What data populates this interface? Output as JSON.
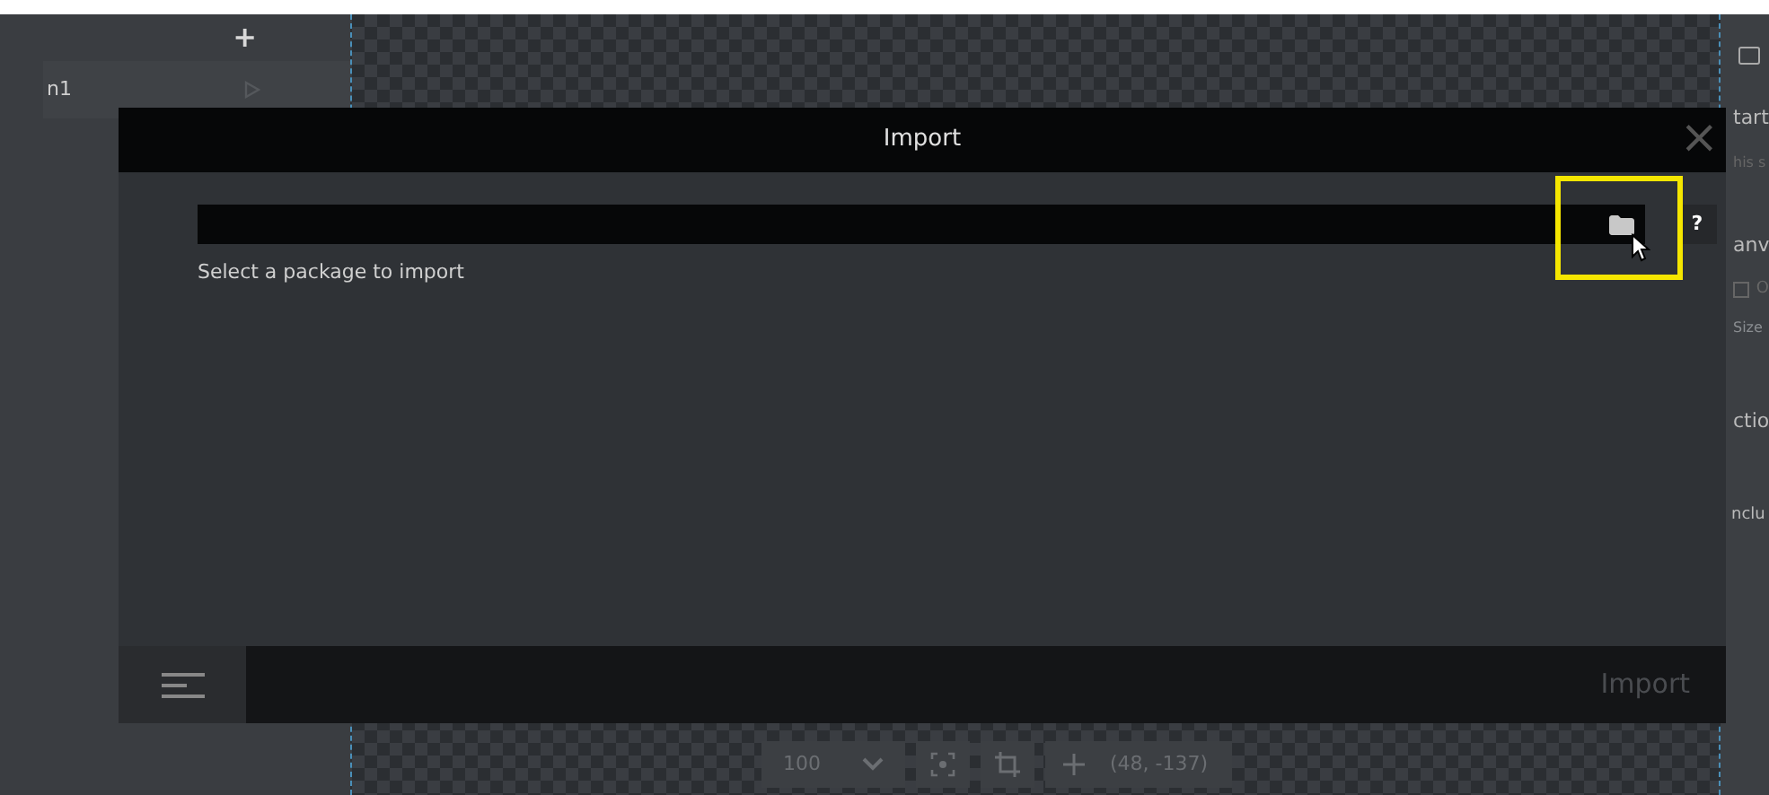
{
  "sidebar": {
    "add_button": "+",
    "item": "n1"
  },
  "canvas_toolbar": {
    "zoom": "100",
    "position": "(48, -137)"
  },
  "right_panel": {
    "texts": [
      "tart",
      "his s",
      "anv",
      "Size",
      "ctio",
      "nclu"
    ],
    "checkbox": {
      "label": "O",
      "checked": false
    }
  },
  "dialog": {
    "title": "Import",
    "close": "×",
    "help": "?",
    "path_field": {
      "kind": "field"
    },
    "hint": "Select a package to import",
    "import_button": "Import",
    "highlight": true
  }
}
